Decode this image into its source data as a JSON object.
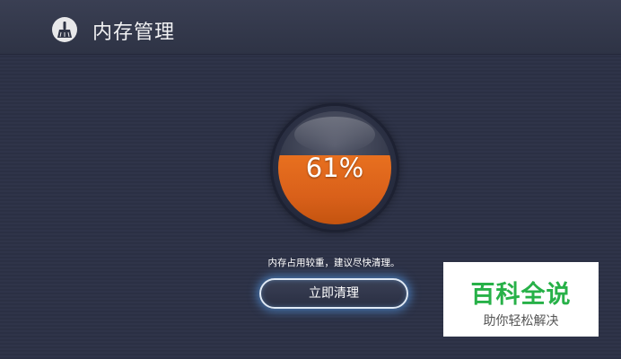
{
  "header": {
    "title": "内存管理",
    "icon": "broom-icon"
  },
  "memory": {
    "percent_text": "61%",
    "usage_fraction": 0.61,
    "fill_color": "#e2661c",
    "message": "内存占用较重，建议尽快清理。"
  },
  "actions": {
    "clean_label": "立即清理"
  },
  "watermark": {
    "brand": "百科全说",
    "slogan": "助你轻松解决",
    "brand_color": "#27b148"
  }
}
